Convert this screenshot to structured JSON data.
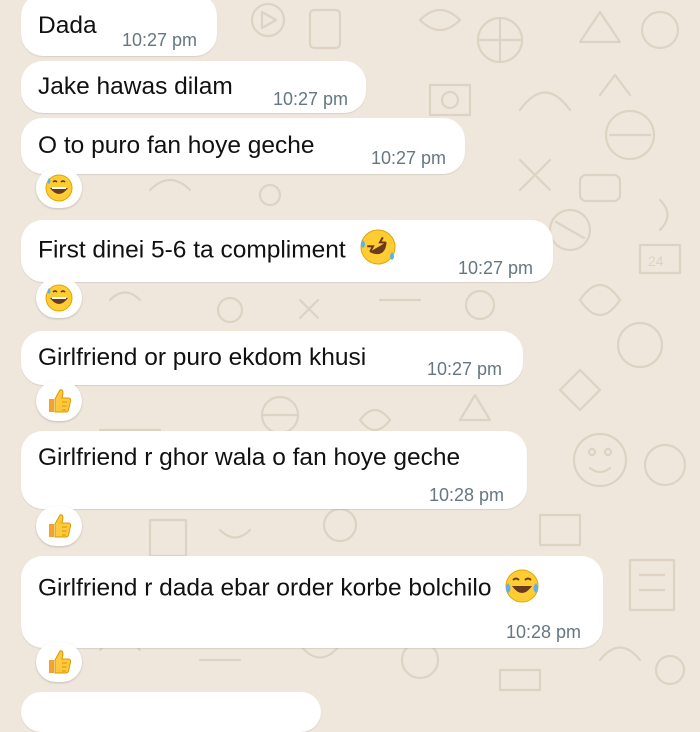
{
  "messages": [
    {
      "text": "Dada",
      "time": "10:27 pm",
      "reaction": null
    },
    {
      "text": "Jake hawas dilam",
      "time": "10:27 pm",
      "reaction": null
    },
    {
      "text": "O to puro fan hoye geche",
      "time": "10:27 pm",
      "reaction": "grinning-sweat-icon"
    },
    {
      "text": "First dinei 5-6 ta compliment",
      "time": "10:27 pm",
      "inline_emoji": "rolling-laughing-icon",
      "reaction": "grinning-sweat-icon"
    },
    {
      "text": "Girlfriend or puro ekdom khusi",
      "time": "10:27 pm",
      "reaction": "thumbs-up-icon"
    },
    {
      "text": "Girlfriend r ghor wala o fan hoye geche",
      "time": "10:28 pm",
      "reaction": "thumbs-up-icon"
    },
    {
      "text": "Girlfriend r dada ebar order korbe bolchilo",
      "time": "10:28 pm",
      "inline_emoji": "tears-of-joy-icon",
      "reaction": "thumbs-up-icon"
    }
  ],
  "colors": {
    "wallpaper": "#efe7dc",
    "bubble": "#ffffff",
    "text": "#111111",
    "timestamp": "#667781"
  }
}
